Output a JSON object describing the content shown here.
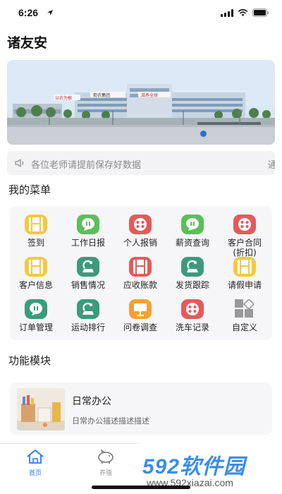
{
  "status": {
    "time": "6:26"
  },
  "app": {
    "title": "诸友安"
  },
  "banner": {
    "sign_left": "以农为根",
    "sign_brand": "街农集团",
    "sign_right": "滋养全球"
  },
  "notice": {
    "text": "各位老师请提前保存好数据",
    "text_next": "通知"
  },
  "menu": {
    "section_title": "我的菜单",
    "items": [
      {
        "label": "签到",
        "color": "#f5c93c",
        "icon": "film-icon"
      },
      {
        "label": "工作日报",
        "color": "#5bbf5a",
        "icon": "chat-icon"
      },
      {
        "label": "个人报销",
        "color": "#e45a5a",
        "icon": "dots-icon"
      },
      {
        "label": "薪资查询",
        "color": "#5bbf5a",
        "icon": "chat-icon"
      },
      {
        "label": "客户合同",
        "label2": "(折扣)",
        "color": "#e45a5a",
        "icon": "dots-icon"
      },
      {
        "label": "客户信息",
        "color": "#f5c93c",
        "icon": "film-icon"
      },
      {
        "label": "销售情况",
        "color": "#3d9a7c",
        "icon": "satellite-icon"
      },
      {
        "label": "应收账款",
        "color": "#e45a5a",
        "icon": "film-icon"
      },
      {
        "label": "发货跟踪",
        "color": "#3d9a7c",
        "icon": "satellite-icon"
      },
      {
        "label": "请假申请",
        "color": "#f5c93c",
        "icon": "film-icon"
      },
      {
        "label": "订单管理",
        "color": "#3d9a7c",
        "icon": "chat-icon"
      },
      {
        "label": "运动排行",
        "color": "#3d9a7c",
        "icon": "satellite-icon"
      },
      {
        "label": "问卷调查",
        "color": "#f0a236",
        "icon": "board-icon"
      },
      {
        "label": "洗车记录",
        "color": "#e45a5a",
        "icon": "dots-icon"
      },
      {
        "label": "自定义",
        "color": "#888888",
        "icon": "grid-icon"
      }
    ]
  },
  "modules": {
    "section_title": "功能模块",
    "items": [
      {
        "title": "日常办公",
        "desc": "日常办公描述描述描述"
      }
    ]
  },
  "tabs": [
    {
      "label": "首页",
      "icon": "home-icon",
      "active": true
    },
    {
      "label": "养殖",
      "icon": "pig-icon",
      "active": false
    },
    {
      "label": "",
      "icon": "clipboard-icon",
      "active": false
    },
    {
      "label": "",
      "icon": "user-icon",
      "active": false
    }
  ],
  "watermark": {
    "logo": "592软件园",
    "url": "www.592xiazai.com"
  },
  "colors": {
    "accent": "#2c7be5",
    "brand_blue": "#3a8ee6"
  }
}
